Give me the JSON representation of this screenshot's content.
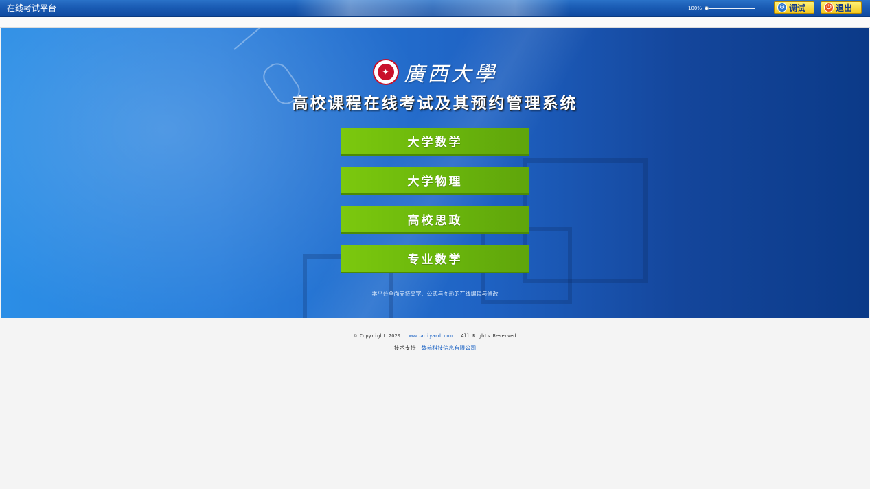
{
  "topbar": {
    "app_title": "在线考试平台",
    "zoom_label": "100%",
    "zoom_level": 0.0,
    "debug_label": "调试",
    "debug_icon": "gear-icon",
    "exit_label": "退出",
    "exit_icon": "power-icon"
  },
  "banner": {
    "university_name": "廣西大學",
    "system_title": "高校课程在线考试及其预约管理系统",
    "courses": [
      {
        "label": "大学数学"
      },
      {
        "label": "大学物理"
      },
      {
        "label": "高校思政"
      },
      {
        "label": "专业数学"
      }
    ],
    "support_note": "本平台全面支持文字、公式与图形的在线编辑与修改",
    "colors": {
      "banner_blue": "#2b8ee6",
      "button_green": "#7cc80e"
    }
  },
  "footer": {
    "copyright_prefix": "© Copyright 2020",
    "site_link": "www.aciyard.com",
    "rights": "All Rights Reserved",
    "support_label": "技术支持",
    "company_link": "数苑科技信息有限公司"
  }
}
